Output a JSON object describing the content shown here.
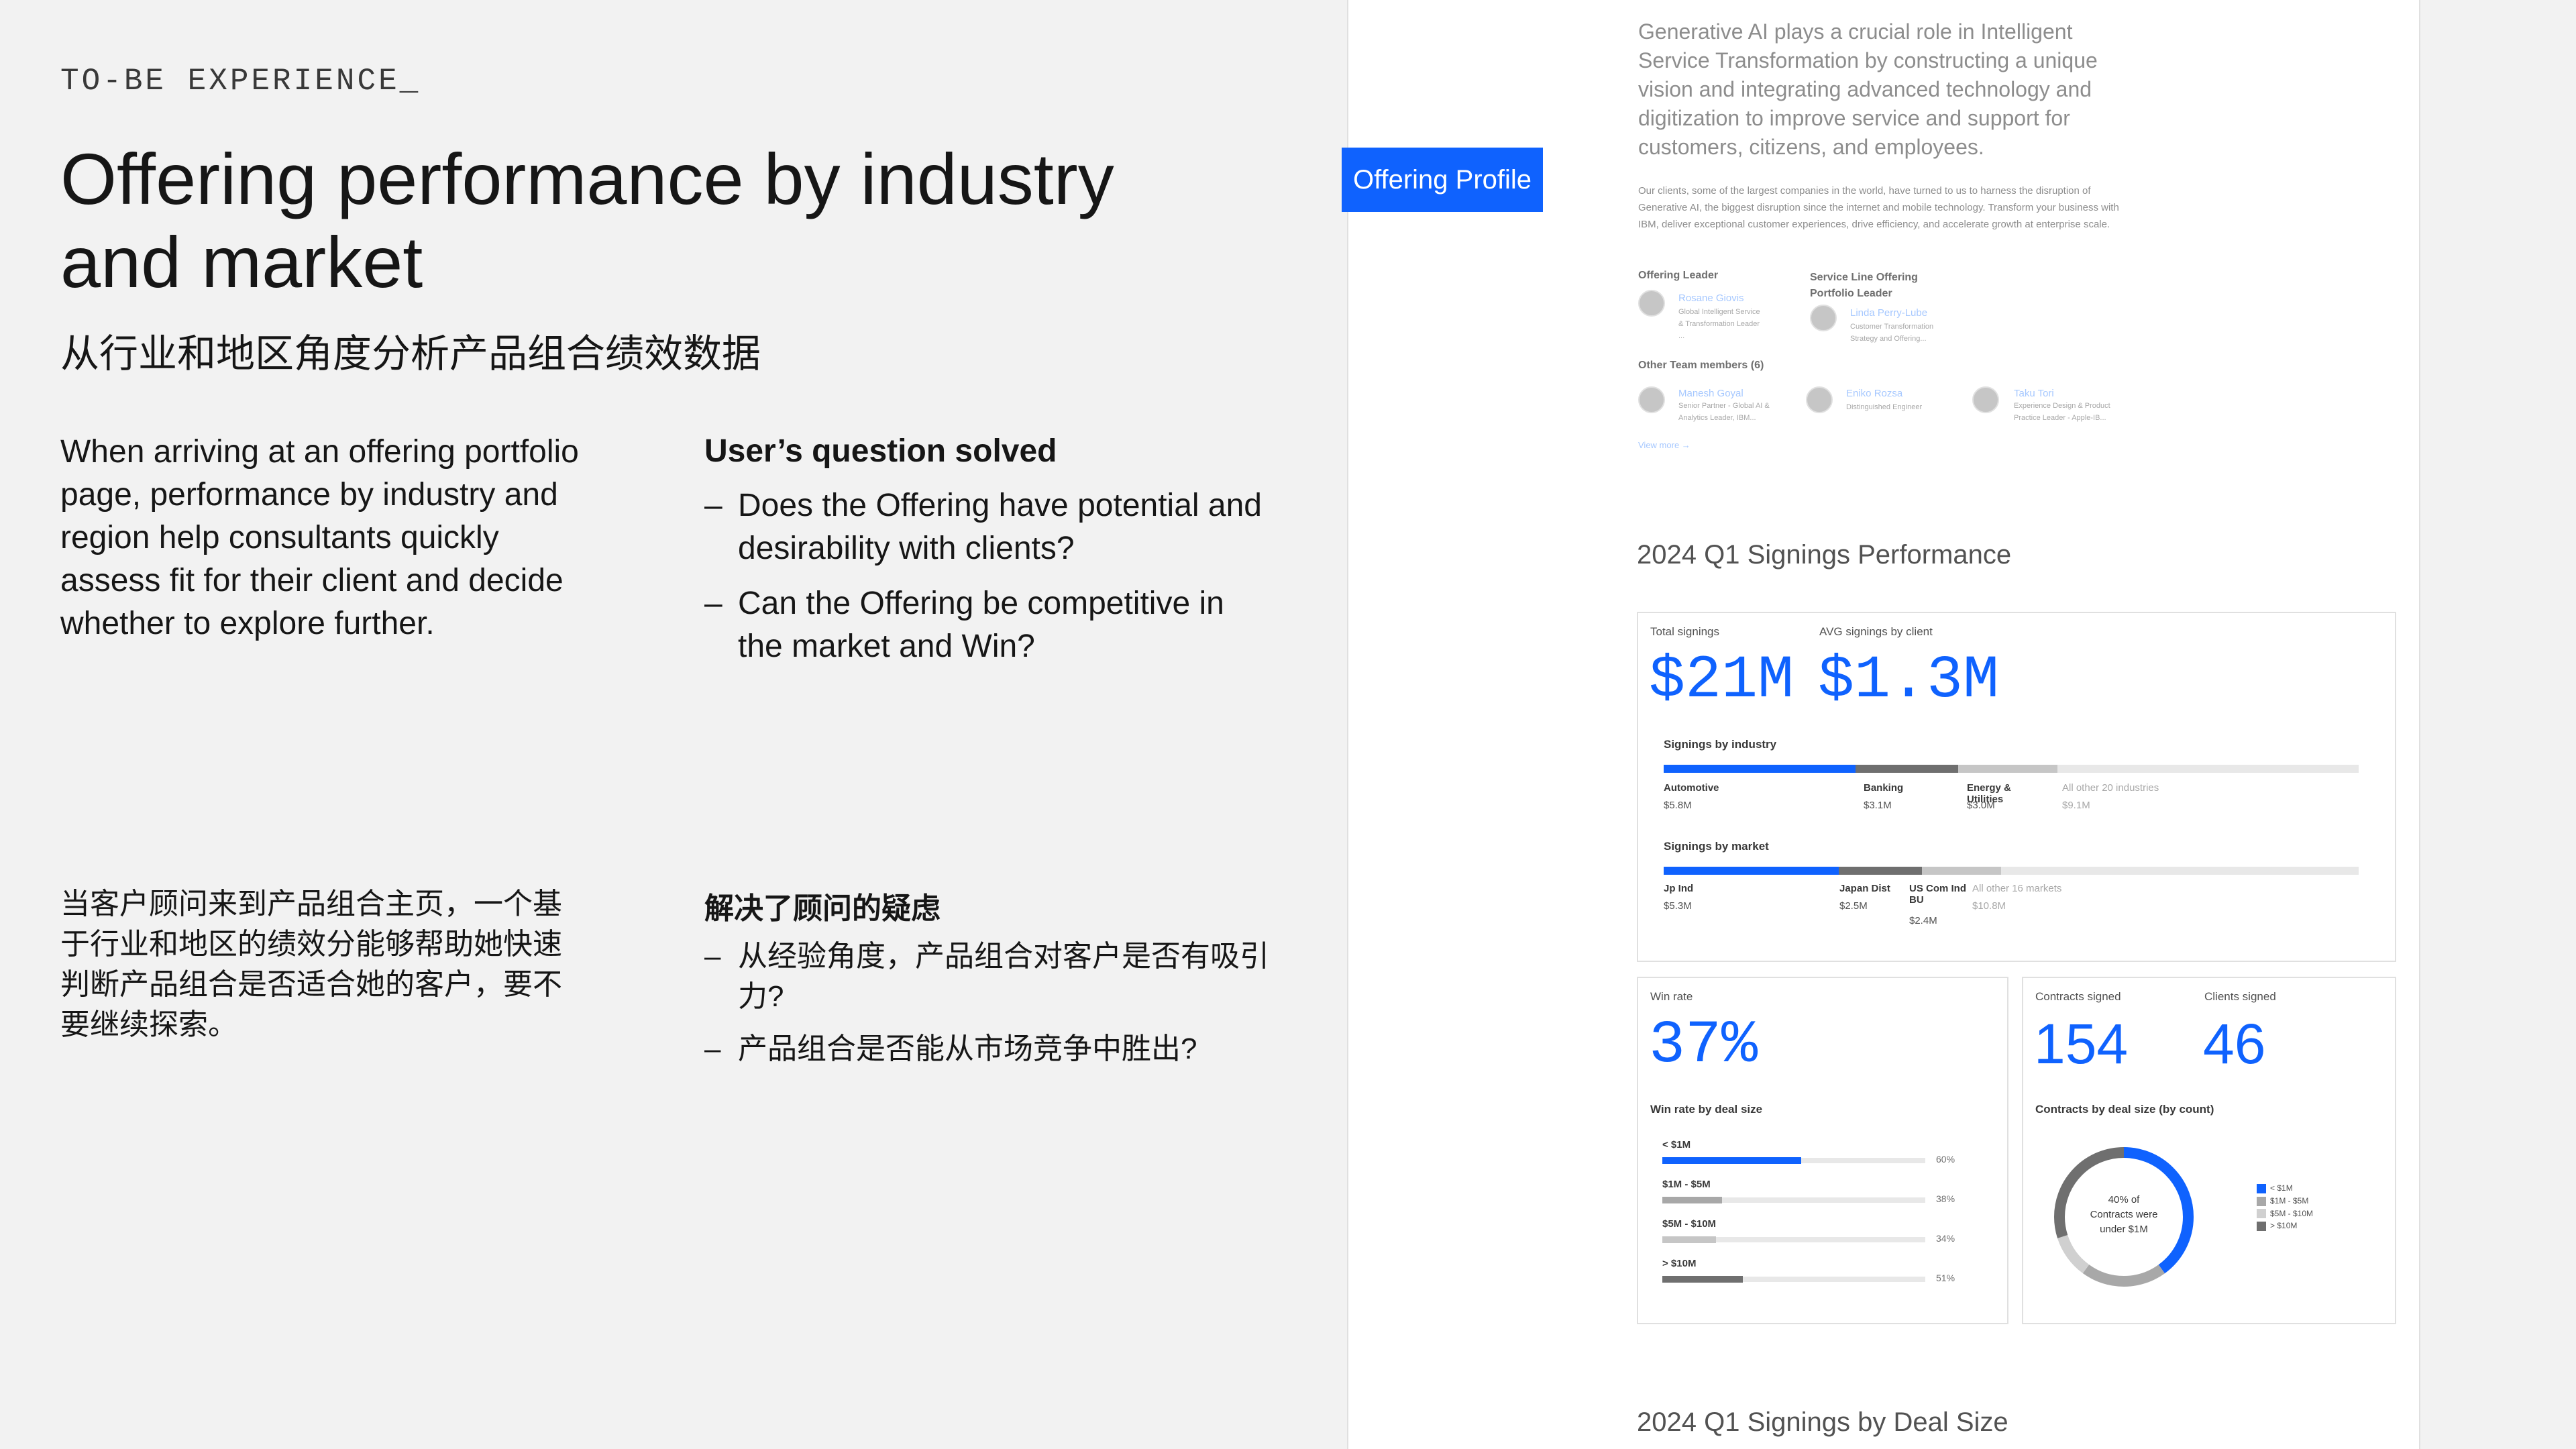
{
  "eyebrow": "TO-BE EXPERIENCE_",
  "title": "Offering performance by industry and market",
  "subtitle": "从行业和地区角度分析产品组合绩效数据",
  "intro_en": "When arriving at an offering portfolio page, performance by industry and region help consultants quickly assess fit for their client and decide whether to explore further.",
  "questions_en": {
    "heading": "User’s question solved",
    "items": [
      "Does the Offering have potential and desirability with clients?",
      "Can the Offering be competitive in the market and Win?"
    ]
  },
  "intro_zh": "当客户顾问来到产品组合主页，一个基于行业和地区的绩效分能够帮助她快速判断产品组合是否适合她的客户，要不要继续探索。",
  "questions_zh": {
    "heading": "解决了顾问的疑虑",
    "items": [
      "从经验角度，产品组合对客户是否有吸引力?",
      "产品组合是否能从市场竞争中胜出?"
    ]
  },
  "panel": {
    "tag": "Offering Profile",
    "intro": "Generative AI plays a crucial role in Intelligent Service Transformation by constructing a unique vision and integrating advanced technology and digitization to improve service and support for customers, citizens, and employees.",
    "detail": "Our clients, some of the largest companies in the world, have turned to us to harness the disruption of Generative AI, the biggest disruption since the internet and mobile technology. Transform your business with IBM, deliver exceptional customer experiences, drive efficiency, and accelerate growth at enterprise scale.",
    "leader_label": "Offering Leader",
    "leader_name": "Rosane Giovis",
    "leader_role": "Global Intelligent Service & Transformation Leader ...",
    "portfolio_label": "Service Line Offering Portfolio Leader",
    "portfolio_name": "Linda Perry-Lube",
    "portfolio_role": "Customer Transformation Strategy and Offering...",
    "team_label": "Other Team members (6)",
    "team": [
      {
        "name": "Manesh Goyal",
        "role": "Senior Partner - Global AI & Analytics Leader, IBM..."
      },
      {
        "name": "Eniko Rozsa",
        "role": "Distinguished Engineer"
      },
      {
        "name": "Taku Tori",
        "role": "Experience Design & Product Practice Leader - Apple-IB..."
      }
    ],
    "view_more": "View more →",
    "section1": "2024 Q1 Signings Performance",
    "section2": "2024 Q1 Signings by Deal Size"
  },
  "signings": {
    "total_label": "Total signings",
    "total": "$21M",
    "avg_label": "AVG signings by client",
    "avg": "$1.3M",
    "industry_label": "Signings by industry",
    "industry": [
      {
        "name": "Automotive",
        "value": "$5.8M",
        "amount": 5.8,
        "color": "#0f62fe"
      },
      {
        "name": "Banking",
        "value": "$3.1M",
        "amount": 3.1,
        "color": "#6f6f6f"
      },
      {
        "name": "Energy & Utilities",
        "value": "$3.0M",
        "amount": 3.0,
        "color": "#c6c6c6"
      },
      {
        "name": "All other 20 industries",
        "value": "$9.1M",
        "amount": 9.1,
        "color": "#e8e8e8"
      }
    ],
    "market_label": "Signings by market",
    "market": [
      {
        "name": "Jp Ind",
        "value": "$5.3M",
        "amount": 5.3,
        "color": "#0f62fe"
      },
      {
        "name": "Japan Dist",
        "value": "$2.5M",
        "amount": 2.5,
        "color": "#6f6f6f"
      },
      {
        "name": "US Com Ind BU",
        "value": "$2.4M",
        "amount": 2.4,
        "color": "#c6c6c6"
      },
      {
        "name": "All other 16 markets",
        "value": "$10.8M",
        "amount": 10.8,
        "color": "#e8e8e8"
      }
    ]
  },
  "winrate": {
    "label": "Win rate",
    "value": "37%",
    "by_label": "Win rate by deal size",
    "rows": [
      {
        "name": "< $1M",
        "pct": "60%",
        "fraction": 0.6,
        "color": "#0f62fe"
      },
      {
        "name": "$1M - $5M",
        "pct": "38%",
        "fraction": 0.38,
        "color": "#a8a8a8"
      },
      {
        "name": "$5M - $10M",
        "pct": "34%",
        "fraction": 0.34,
        "color": "#c6c6c6"
      },
      {
        "name": "> $10M",
        "pct": "51%",
        "fraction": 0.51,
        "color": "#6f6f6f"
      }
    ]
  },
  "contracts": {
    "contracts_label": "Contracts signed",
    "contracts": "154",
    "clients_label": "Clients signed",
    "clients": "46",
    "by_label": "Contracts by deal size (by count)",
    "donut_text": [
      "40% of",
      "Contracts were",
      "under $1M"
    ],
    "legend": [
      {
        "name": "< $1M",
        "share": 0.4,
        "color": "#0f62fe"
      },
      {
        "name": "$1M - $5M",
        "share": 0.2,
        "color": "#a8a8a8"
      },
      {
        "name": "$5M - $10M",
        "share": 0.1,
        "color": "#d0d0d0"
      },
      {
        "name": "> $10M",
        "share": 0.3,
        "color": "#6f6f6f"
      }
    ]
  }
}
